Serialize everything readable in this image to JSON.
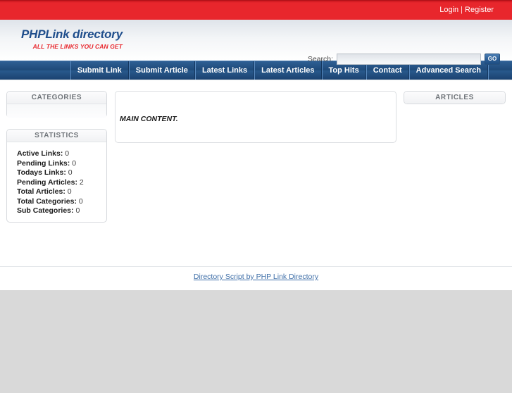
{
  "topbar": {
    "login_label": "Login",
    "separator": "|",
    "register_label": "Register"
  },
  "header": {
    "logo_main": "PHPLink directory",
    "logo_tagline": "ALL THE LINKS YOU CAN GET",
    "search_label": "Search:",
    "search_value": "",
    "search_placeholder": "",
    "go_label": "GO"
  },
  "nav": {
    "items": [
      {
        "label": "Submit Link"
      },
      {
        "label": "Submit Article"
      },
      {
        "label": "Latest Links"
      },
      {
        "label": "Latest Articles"
      },
      {
        "label": "Top Hits"
      },
      {
        "label": "Contact"
      },
      {
        "label": "Advanced Search"
      }
    ]
  },
  "sidebar_left": {
    "categories_title": "CATEGORIES",
    "categories_items": [],
    "statistics_title": "STATISTICS",
    "statistics": [
      {
        "label": "Active Links:",
        "value": "0"
      },
      {
        "label": "Pending Links:",
        "value": "0"
      },
      {
        "label": "Todays Links:",
        "value": "0"
      },
      {
        "label": "Pending Articles:",
        "value": "2"
      },
      {
        "label": "Total Articles:",
        "value": "0"
      },
      {
        "label": "Total Categories:",
        "value": "0"
      },
      {
        "label": "Sub Categories:",
        "value": "0"
      }
    ]
  },
  "main": {
    "content_text": "MAIN CONTENT."
  },
  "sidebar_right": {
    "articles_title": "ARTICLES"
  },
  "footer": {
    "credit_link": "Directory Script by PHP Link Directory"
  },
  "colors": {
    "topbar_red": "#e8262c",
    "nav_blue": "#1f4a79",
    "logo_blue": "#1f4e8c",
    "tagline_red": "#e8262c",
    "link_blue": "#3f6fa8",
    "panel_border": "#d7dade",
    "bottom_gray": "#d9d9d9"
  }
}
